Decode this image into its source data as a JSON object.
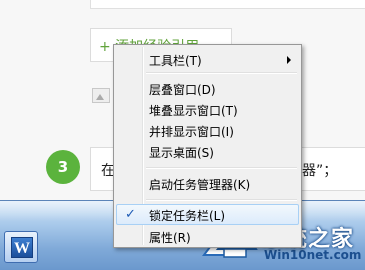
{
  "background": {
    "add_reference": "+ 添加经验引用",
    "step_number": "3",
    "step_text_left": "在",
    "step_text_right": "理器”；"
  },
  "taskbar": {
    "app_letter": "W"
  },
  "watermark": {
    "title": "系统之家",
    "url": "Win10net.com"
  },
  "context_menu": {
    "items": [
      {
        "label": "工具栏(T)",
        "submenu": true
      },
      {
        "label": "层叠窗口(D)"
      },
      {
        "label": "堆叠显示窗口(T)"
      },
      {
        "label": "并排显示窗口(I)"
      },
      {
        "label": "显示桌面(S)"
      },
      {
        "label": "启动任务管理器(K)"
      },
      {
        "label": "锁定任务栏(L)",
        "checked": true
      },
      {
        "label": "属性(R)"
      }
    ],
    "check_mark": "✓"
  },
  "colors": {
    "accent_green": "#5bb33d",
    "link_green": "#61a33b",
    "taskbar_blue": "#7fa9d8",
    "menu_highlight": "#dcebfb"
  }
}
